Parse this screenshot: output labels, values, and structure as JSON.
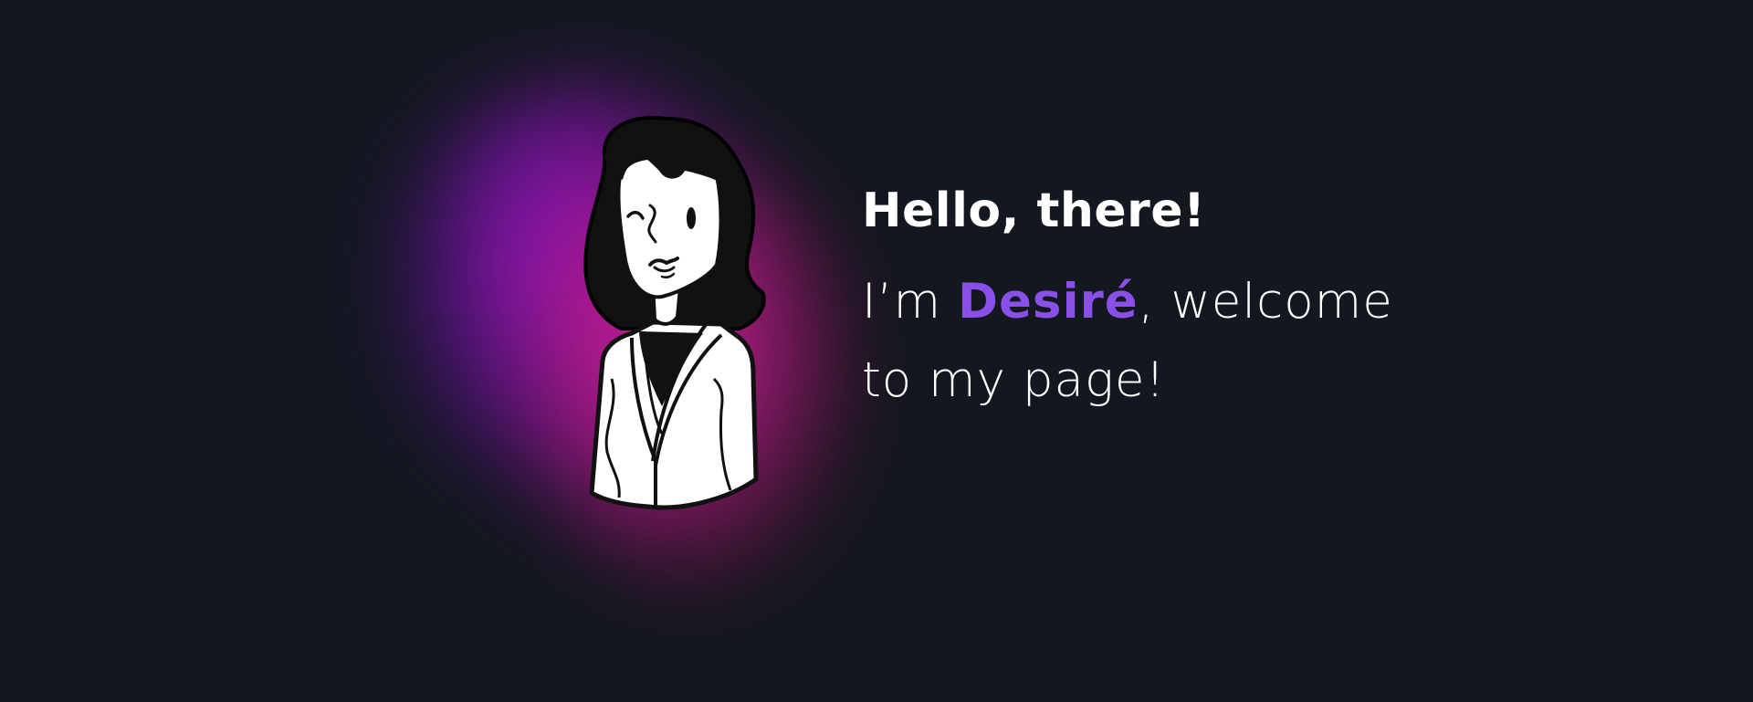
{
  "hero": {
    "greeting": "Hello, there!",
    "intro_prefix": "I’m ",
    "name": "Desiré",
    "intro_suffix_line1": ", welcome",
    "intro_line2": "to my page!"
  },
  "avatar": {
    "icon": "woman-portrait-illustration"
  },
  "colors": {
    "background": "#13171f",
    "name_accent": "#8a4fe8",
    "glow_magenta": "#b914c8",
    "glow_pink": "#d72396",
    "glow_purple": "#6e1ebe",
    "text": "#ffffff"
  }
}
